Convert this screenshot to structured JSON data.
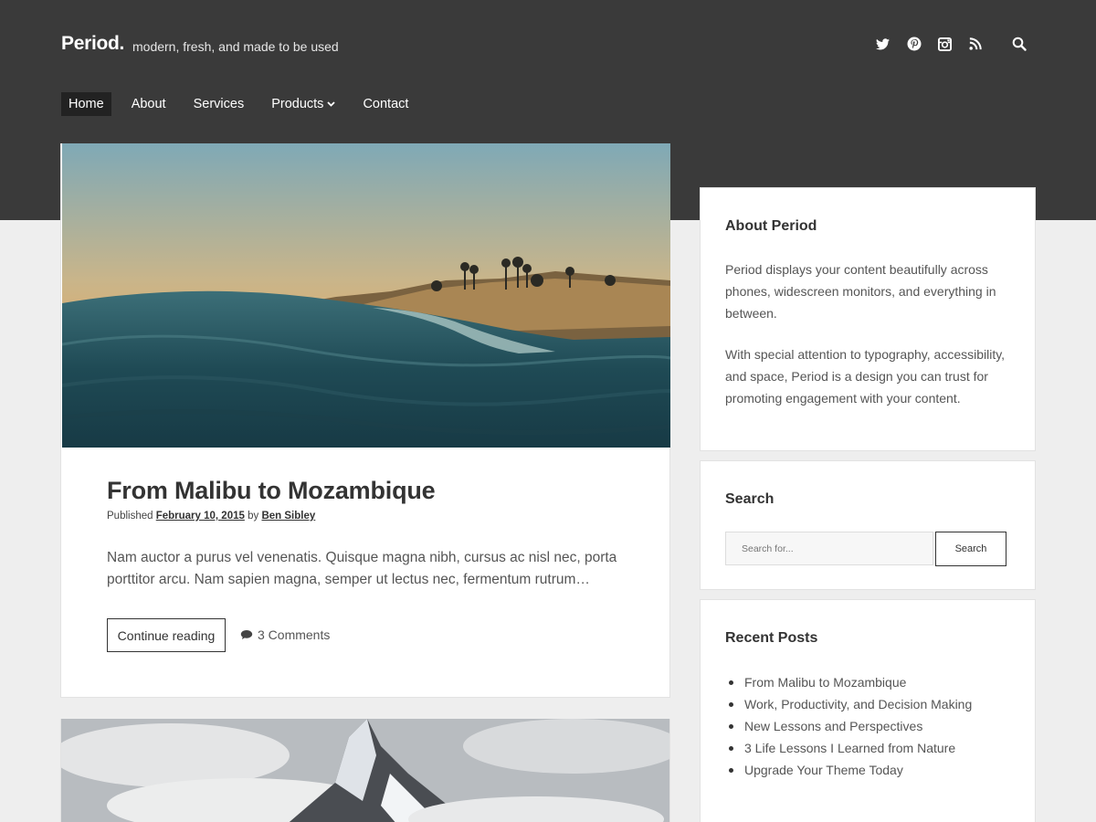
{
  "site": {
    "title": "Period.",
    "tagline": "modern, fresh, and made to be used"
  },
  "social_icons": [
    "twitter-icon",
    "pinterest-icon",
    "instagram-icon",
    "rss-icon",
    "search-icon"
  ],
  "nav": {
    "items": [
      {
        "label": "Home",
        "active": true
      },
      {
        "label": "About"
      },
      {
        "label": "Services"
      },
      {
        "label": "Products",
        "has_dropdown": true
      },
      {
        "label": "Contact"
      }
    ]
  },
  "post": {
    "title": "From Malibu to Mozambique",
    "meta_prefix": "Published",
    "date": "February 10, 2015",
    "meta_by": "by",
    "author": "Ben Sibley",
    "excerpt": "Nam auctor a purus vel venenatis. Quisque magna nibh, cursus ac nisl nec, porta porttitor arcu. Nam sapien magna, semper ut lectus nec, fermentum rutrum…",
    "continue_label": "Continue reading",
    "comments_label": "3 Comments"
  },
  "sidebar": {
    "about": {
      "title": "About Period",
      "para1": "Period displays your content beautifully across phones, widescreen monitors, and everything in between.",
      "para2": "With special attention to typography, accessibility, and space, Period is a design you can trust for promoting engagement with your content."
    },
    "search": {
      "title": "Search",
      "placeholder": "Search for...",
      "button_label": "Search"
    },
    "recent": {
      "title": "Recent Posts",
      "items": [
        "From Malibu to Mozambique",
        "Work, Productivity, and Decision Making",
        "New Lessons and Perspectives",
        "3 Life Lessons I Learned from Nature",
        "Upgrade Your Theme Today"
      ]
    }
  },
  "colors": {
    "header": "#3a3a3a",
    "page_bg": "#eeeeee",
    "active_nav": "#222222"
  }
}
